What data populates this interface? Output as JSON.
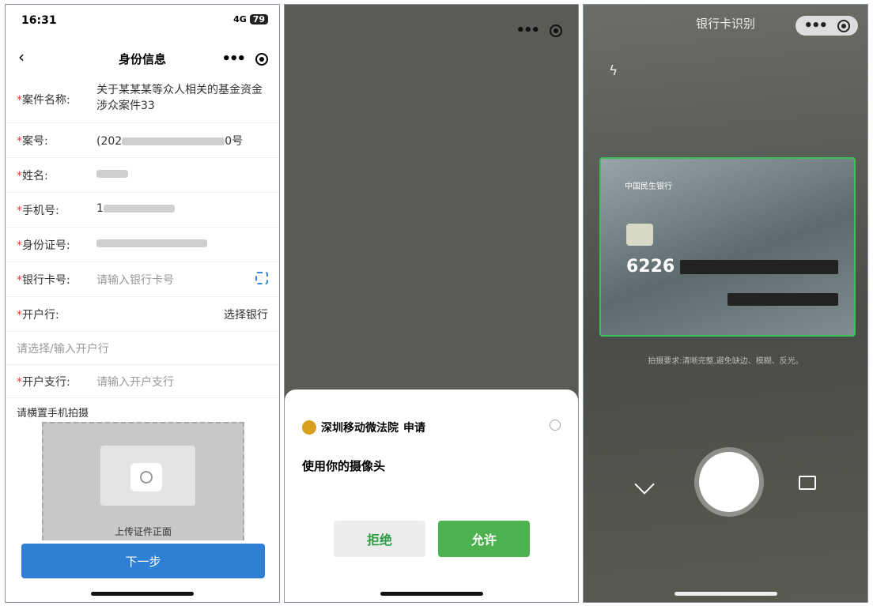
{
  "p1": {
    "time": "16:31",
    "net": "4G",
    "battery": "79",
    "title": "身份信息",
    "case_name_label": "案件名称:",
    "case_name": "关于某某某等众人相关的基金资金涉众案件33",
    "case_no_label": "案号:",
    "case_no_a": "(202",
    "case_no_b": "0号",
    "name_label": "姓名:",
    "phone_label": "手机号:",
    "phone_a": "1",
    "id_label": "身份证号:",
    "card_label": "银行卡号:",
    "card_ph": "请输入银行卡号",
    "bank_label": "开户行:",
    "bank_select": "选择银行",
    "bank_ph": "请选择/输入开户行",
    "branch_label": "开户支行:",
    "branch_ph": "请输入开户支行",
    "hint": "请横置手机拍摄",
    "upload": "上传证件正面",
    "next": "下一步"
  },
  "p2": {
    "app": "深圳移动微法院",
    "req": "申请",
    "msg": "使用你的摄像头",
    "deny": "拒绝",
    "allow": "允许"
  },
  "p3": {
    "title": "银行卡识别",
    "bank": "中国民生银行",
    "card_digits": "6226",
    "tip": "拍摄要求:清晰完整,避免缺边、模糊、反光。"
  },
  "icons": [
    "flash-icon",
    "chevron-down-icon",
    "gallery-icon",
    "scan-icon",
    "info-icon",
    "camera-icon"
  ]
}
